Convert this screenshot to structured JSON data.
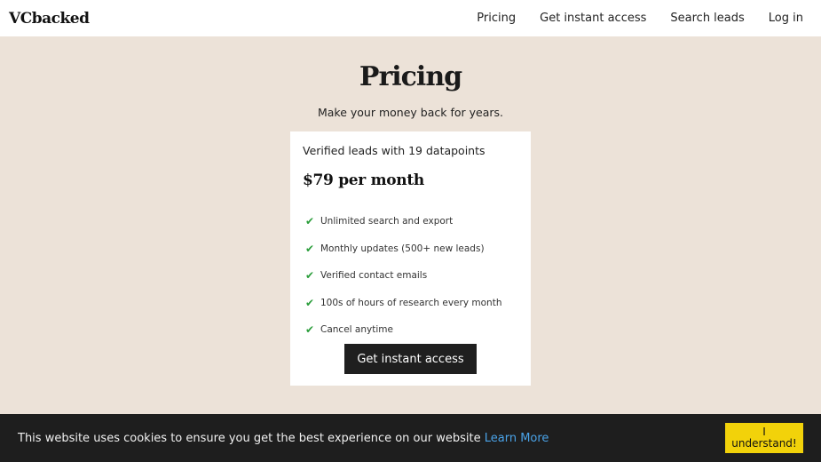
{
  "header": {
    "logo": "VCbacked",
    "nav": [
      {
        "label": "Pricing"
      },
      {
        "label": "Get instant access"
      },
      {
        "label": "Search leads"
      },
      {
        "label": "Log in"
      }
    ]
  },
  "hero": {
    "title": "Pricing",
    "subtitle": "Make your money back for years."
  },
  "pricing_card": {
    "heading": "Verified leads with 19 datapoints",
    "price": "$79 per month",
    "features": [
      {
        "text": "Unlimited search and export",
        "icon": "checkmark-icon"
      },
      {
        "text": "Monthly updates (500+ new leads)",
        "icon": "checkmark-icon"
      },
      {
        "text": "Verified contact emails",
        "icon": "checkmark-icon"
      },
      {
        "text": "100s of hours of research every month",
        "icon": "checkmark-icon"
      },
      {
        "text": "Cancel anytime",
        "icon": "checkmark-icon"
      }
    ],
    "check_glyph": "✔",
    "cta_label": "Get instant access"
  },
  "cookie_banner": {
    "text": "This website uses cookies to ensure you get the best experience on our website",
    "link_label": "Learn More",
    "button_label": "I understand!"
  },
  "colors": {
    "page_background": "#ece2d8",
    "check_green": "#2a9d3a",
    "cta_background": "#1f1f1f",
    "cookie_bar": "#1e1e1e",
    "cookie_link": "#4aa3e8",
    "cookie_button": "#f2d20a"
  }
}
